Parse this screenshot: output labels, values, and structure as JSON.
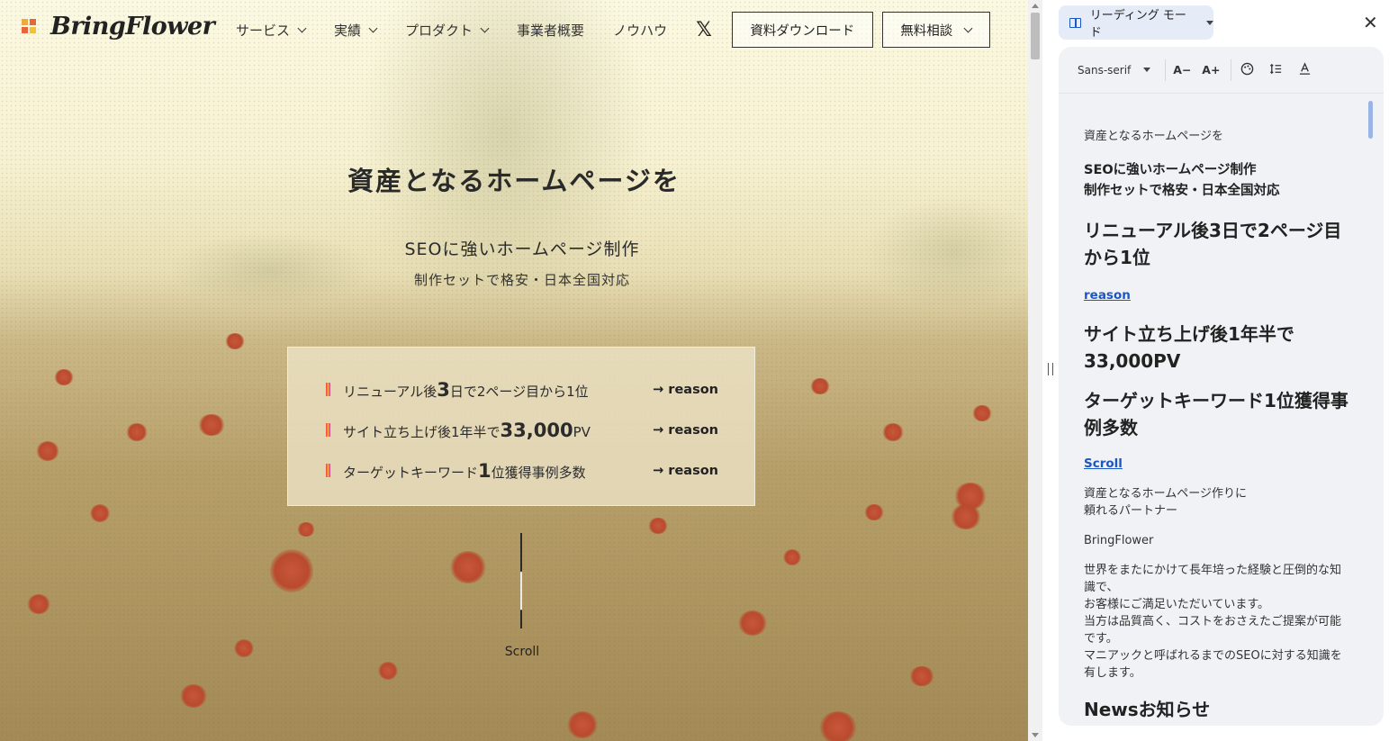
{
  "site": {
    "logo_text": "BringFlower",
    "nav": {
      "items": [
        "サービス",
        "実績",
        "プロダクト",
        "事業者概要",
        "ノウハウ"
      ],
      "x_label": "𝕏",
      "download_label": "資料ダウンロード",
      "consult_label": "無料相談"
    },
    "hero": {
      "title": "資産となるホームページを",
      "subtitle": "SEOに強いホームページ制作",
      "subtitle2": "制作セットで格安・日本全国対応"
    },
    "reasons": [
      {
        "pre": "リニューアル後",
        "num": "3",
        "post": "日で2ページ目から1位",
        "link": "→ reason"
      },
      {
        "pre": "サイト立ち上げ後1年半で",
        "num": "33,000",
        "post": "PV",
        "link": "→ reason"
      },
      {
        "pre": "ターゲットキーワード",
        "num": "1",
        "post": "位獲得事例多数",
        "link": "→ reason"
      }
    ],
    "scroll_label": "Scroll"
  },
  "panel": {
    "mode_label": "リーディング モード",
    "close_icon": "close-icon",
    "toolbar": {
      "font": "Sans-serif",
      "smaller": "A−",
      "larger": "A+"
    },
    "content": {
      "p1": "資産となるホームページを",
      "h1a": "SEOに強いホームページ制作",
      "h1b": "制作セットで格安・日本全国対応",
      "h2a": "リニューアル後3日で2ページ目",
      "h2b": "から1位",
      "link1": "reason",
      "h3a": "サイト立ち上げ後1年半で",
      "h3b": "33,000PV",
      "h4a": "ターゲットキーワード1位獲得事",
      "h4b": "例多数",
      "link2": "Scroll",
      "p2a": "資産となるホームページ作りに",
      "p2b": "頼れるパートナー",
      "p3": "BringFlower",
      "p4": [
        "世界をまたにかけて長年培った経験と圧倒的な知",
        "識で、",
        "お客様にご満足いただいています。",
        "当方は品質高く、コストをおさえたご提案が可能",
        "です。",
        "マニアックと呼ばれるまでのSEOに対する知識を",
        "有します。"
      ],
      "h5": "Newsお知らせ"
    }
  },
  "colors": {
    "accent_blue": "#1a56c4",
    "panel_bg": "#f1f2f5",
    "chip_bg": "#e5ebf7"
  }
}
